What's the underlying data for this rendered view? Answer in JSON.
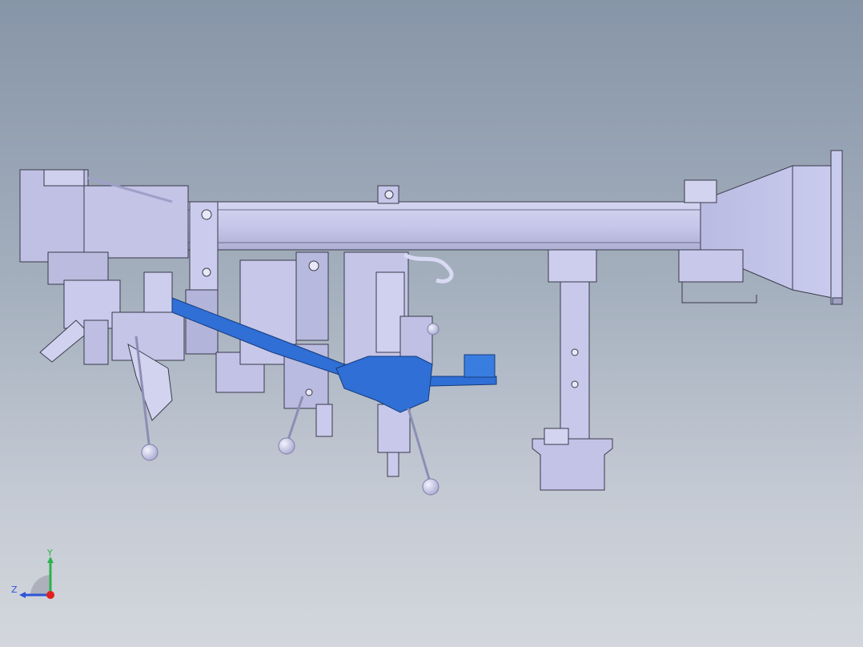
{
  "viewport": {
    "background_top": "#8795a8",
    "background_bottom": "#d3d7dd"
  },
  "model": {
    "body_color": "#c5c6e8",
    "edge_color": "#3a3a4a",
    "accent_part_color": "#2f6fd6",
    "handle_ball_color": "#cfd0ea"
  },
  "triad": {
    "y_label": "Y",
    "z_label": "Z",
    "y_color": "#2bb24c",
    "z_color": "#2f54d6",
    "x_color": "#e02020"
  }
}
